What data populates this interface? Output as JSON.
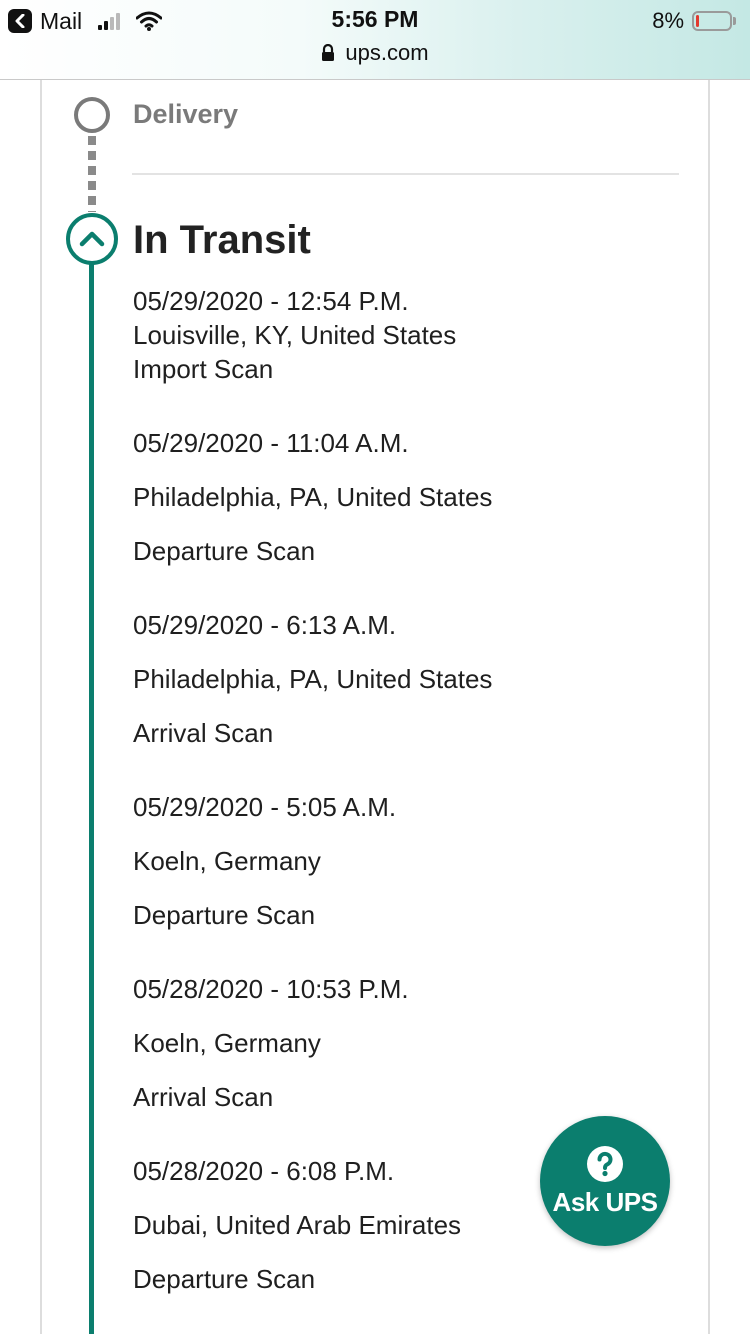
{
  "status_bar": {
    "back_app": "Mail",
    "time": "5:56 PM",
    "url": "ups.com",
    "battery_percent": "8%",
    "battery_level": 0.08,
    "battery_color": "#e23a2f"
  },
  "timeline": {
    "delivery_label": "Delivery",
    "in_transit_label": "In Transit",
    "accent_color": "#0b7e6e",
    "events": [
      {
        "datetime": "05/29/2020 - 12:54 P.M.",
        "location": "Louisville, KY, United States",
        "activity": "Import Scan"
      },
      {
        "datetime": "05/29/2020 - 11:04 A.M.",
        "location": "Philadelphia, PA, United States",
        "activity": "Departure Scan"
      },
      {
        "datetime": "05/29/2020 - 6:13 A.M.",
        "location": "Philadelphia, PA, United States",
        "activity": "Arrival Scan"
      },
      {
        "datetime": "05/29/2020 - 5:05 A.M.",
        "location": "Koeln, Germany",
        "activity": "Departure Scan"
      },
      {
        "datetime": "05/28/2020 - 10:53 P.M.",
        "location": "Koeln, Germany",
        "activity": "Arrival Scan"
      },
      {
        "datetime": "05/28/2020 - 6:08 P.M.",
        "location": "Dubai, United Arab Emirates",
        "activity": "Departure Scan"
      }
    ]
  },
  "ask_ups": {
    "label": "Ask UPS",
    "icon": "question-circle-icon"
  }
}
